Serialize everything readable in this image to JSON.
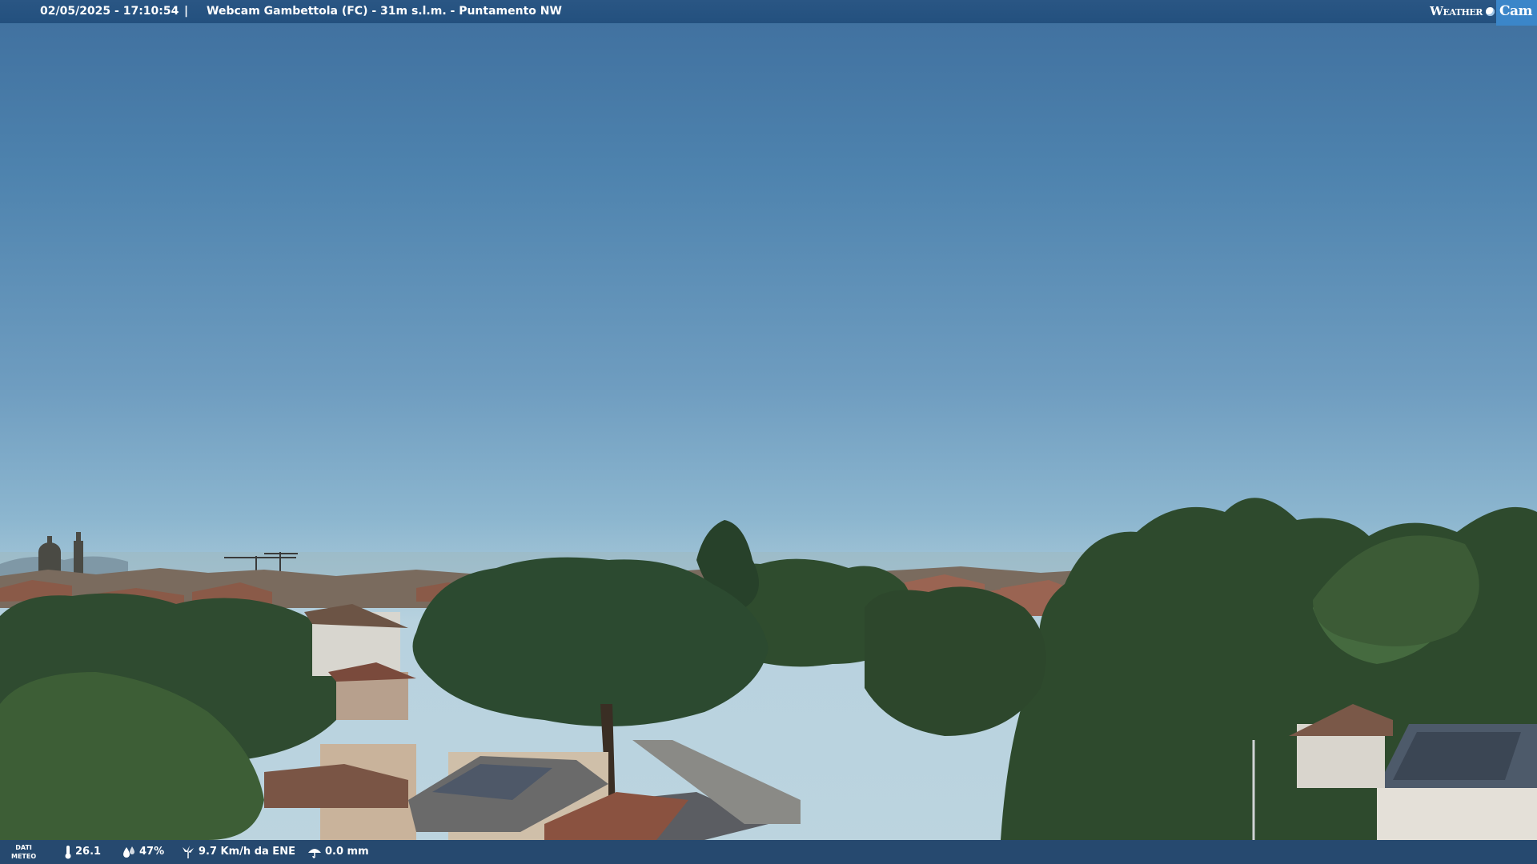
{
  "header": {
    "datetime": "02/05/2025 - 17:10:54",
    "separator": "|",
    "title": "Webcam Gambettola (FC) -  31m s.l.m. - Puntamento NW",
    "brand_weather": "Weather",
    "brand_cam": "Cam"
  },
  "weather_bar": {
    "label_line1": "DATI",
    "label_line2": "METEO",
    "temperature": "26.1",
    "humidity": "47%",
    "wind": "9.7 Km/h da ENE",
    "rain": "0.0 mm",
    "icons": [
      "thermometer-icon",
      "humidity-icon",
      "wind-icon",
      "rain-icon"
    ]
  },
  "colors": {
    "sky_top": "#3f6f9e",
    "sky_horizon": "#bcd4df",
    "bar": "#23507e",
    "trees": "#2f4a2c"
  }
}
